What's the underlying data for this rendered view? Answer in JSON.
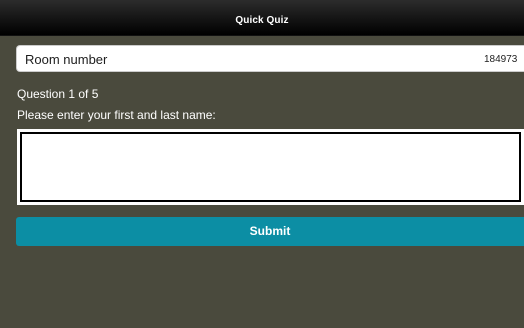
{
  "header": {
    "title": "Quick Quiz"
  },
  "room": {
    "label": "Room number",
    "value": "184973"
  },
  "question": {
    "counter": "Question 1 of 5",
    "prompt": "Please enter your first and last name:",
    "answer_value": ""
  },
  "actions": {
    "submit_label": "Submit"
  },
  "colors": {
    "background": "#4a4a3d",
    "header": "#000000",
    "submit": "#0c8ea4"
  }
}
